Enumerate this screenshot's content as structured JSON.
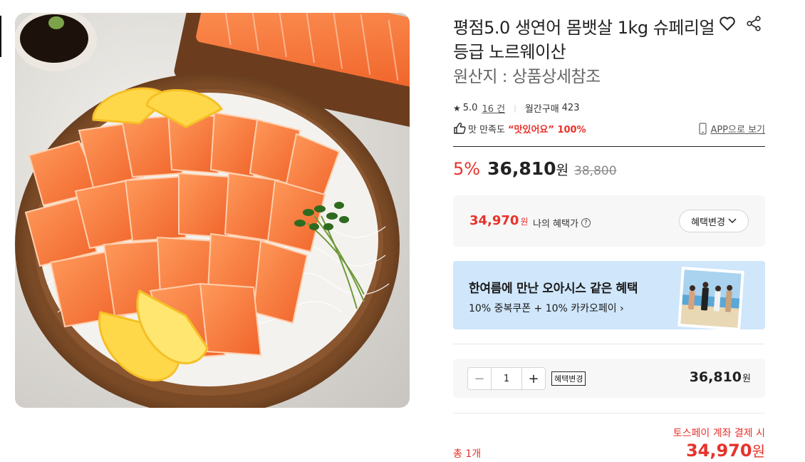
{
  "product": {
    "title": "평점5.0 생연어 몸뱃살 1kg 슈페리얼등급 노르웨이산",
    "origin": "원산지 : 상품상세참조",
    "image_alt": "salmon-sashimi-platter"
  },
  "rating": {
    "score": "5.0",
    "review_count": "16 건",
    "monthly_label": "월간구매",
    "monthly_count": "423"
  },
  "satisfaction": {
    "label": "맛 만족도",
    "value": "“맛있어요” 100%",
    "app_link": "APP으로 보기"
  },
  "price": {
    "discount": "5%",
    "amount": "36,810",
    "won": "원",
    "original": "38,800"
  },
  "benefit": {
    "amount": "34,970",
    "won": "원",
    "label": "나의 혜택가",
    "help": "?",
    "change_button": "혜택변경"
  },
  "promo": {
    "title": "한여름에 만난 오아시스 같은 혜택",
    "subtitle": "10% 중복쿠폰 + 10% 카카오페이 ›"
  },
  "quantity": {
    "minus": "−",
    "value": "1",
    "plus": "+",
    "change_button": "혜택변경",
    "price": "36,810",
    "won": "원"
  },
  "payment": {
    "toss_label": "토스페이 계좌 결제 시",
    "total_label": "총 1개",
    "total_amount": "34,970",
    "won": "원"
  },
  "colors": {
    "accent_red": "#e8322b",
    "promo_bg": "#cfe6fb",
    "panel_bg": "#f7f7f8"
  }
}
